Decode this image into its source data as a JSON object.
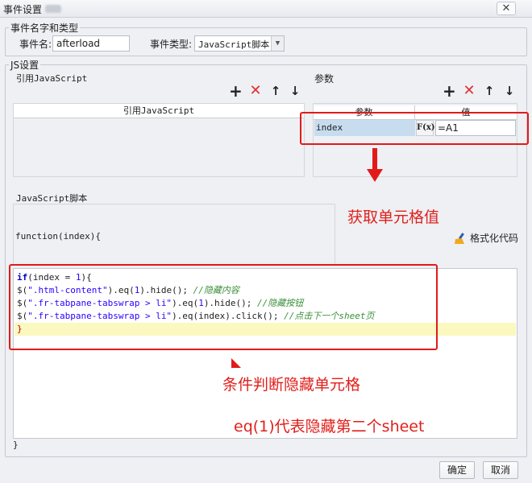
{
  "window": {
    "title": "事件设置"
  },
  "event_section": {
    "legend": "事件名字和类型",
    "name_label": "事件名:",
    "name_value": "afterload",
    "type_label": "事件类型:",
    "type_value": "JavaScript脚本"
  },
  "js_section": {
    "legend": "JS设置",
    "ref_title": "引用JavaScript",
    "ref_table_header": "引用JavaScript",
    "params_title": "参数",
    "params_headers": [
      "参数",
      "值"
    ],
    "param_name": "index",
    "param_formula_icon": "F(x)",
    "param_value": "=A1",
    "script_title": "JavaScript脚本",
    "function_signature": "function(index){",
    "format_code_label": "格式化代码",
    "closing_brace": "}",
    "code_lines": [
      "if(index = 1){",
      "$(\".html-content\").eq(1).hide(); //隐藏内容",
      "$(\".fr-tabpane-tabswrap > li\").eq(1).hide(); //隐藏按钮",
      "$(\".fr-tabpane-tabswrap > li\").eq(index).click(); //点击下一个sheet页",
      "}"
    ]
  },
  "annotations": {
    "get_cell_value": "获取单元格值",
    "condition_hide": "条件判断隐藏单元格",
    "eq_note": "eq(1)代表隐藏第二个sheet"
  },
  "footer": {
    "ok_label": "确定",
    "cancel_label": "取消"
  },
  "colors": {
    "annotation_red": "#e21a1a",
    "code_highlight": "#fbf8c0"
  }
}
